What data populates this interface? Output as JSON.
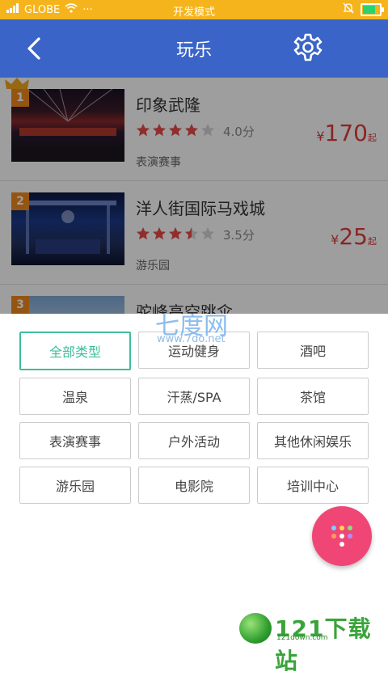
{
  "status": {
    "carrier": "GLOBE",
    "center": "开发模式",
    "dots": "···"
  },
  "appbar": {
    "title": "玩乐"
  },
  "items": [
    {
      "rank": "1",
      "name": "印象武隆",
      "rating": 4.0,
      "score": "4.0分",
      "currency": "¥",
      "price": "170",
      "unit": "起",
      "category": "表演赛事"
    },
    {
      "rank": "2",
      "name": "洋人街国际马戏城",
      "rating": 3.5,
      "score": "3.5分",
      "currency": "¥",
      "price": "25",
      "unit": "起",
      "category": "游乐园"
    },
    {
      "rank": "3",
      "name": "驼峰高空跳伞"
    }
  ],
  "filters": [
    {
      "label": "全部类型",
      "selected": true
    },
    {
      "label": "运动健身",
      "selected": false
    },
    {
      "label": "酒吧",
      "selected": false
    },
    {
      "label": "温泉",
      "selected": false
    },
    {
      "label": "汗蒸/SPA",
      "selected": false
    },
    {
      "label": "茶馆",
      "selected": false
    },
    {
      "label": "表演赛事",
      "selected": false
    },
    {
      "label": "户外活动",
      "selected": false
    },
    {
      "label": "其他休闲娱乐",
      "selected": false
    },
    {
      "label": "游乐园",
      "selected": false
    },
    {
      "label": "电影院",
      "selected": false
    },
    {
      "label": "培训中心",
      "selected": false
    }
  ],
  "watermarks": {
    "top_logo": "七度网",
    "top_url": "www.7do.net",
    "bottom_logo": "121下载站",
    "bottom_url": "121down.com"
  },
  "colors": {
    "status": "#f6b41c",
    "appbar": "#3a64c8",
    "accent": "#3dbd9b",
    "price": "#e03c3c",
    "fab": "#f04676",
    "rank": "#f08a1e"
  },
  "icons": {
    "back": "chevron-left-icon",
    "settings": "gear-icon",
    "fab": "grid-dots-icon",
    "star": "star-icon",
    "crown": "crown-icon"
  }
}
